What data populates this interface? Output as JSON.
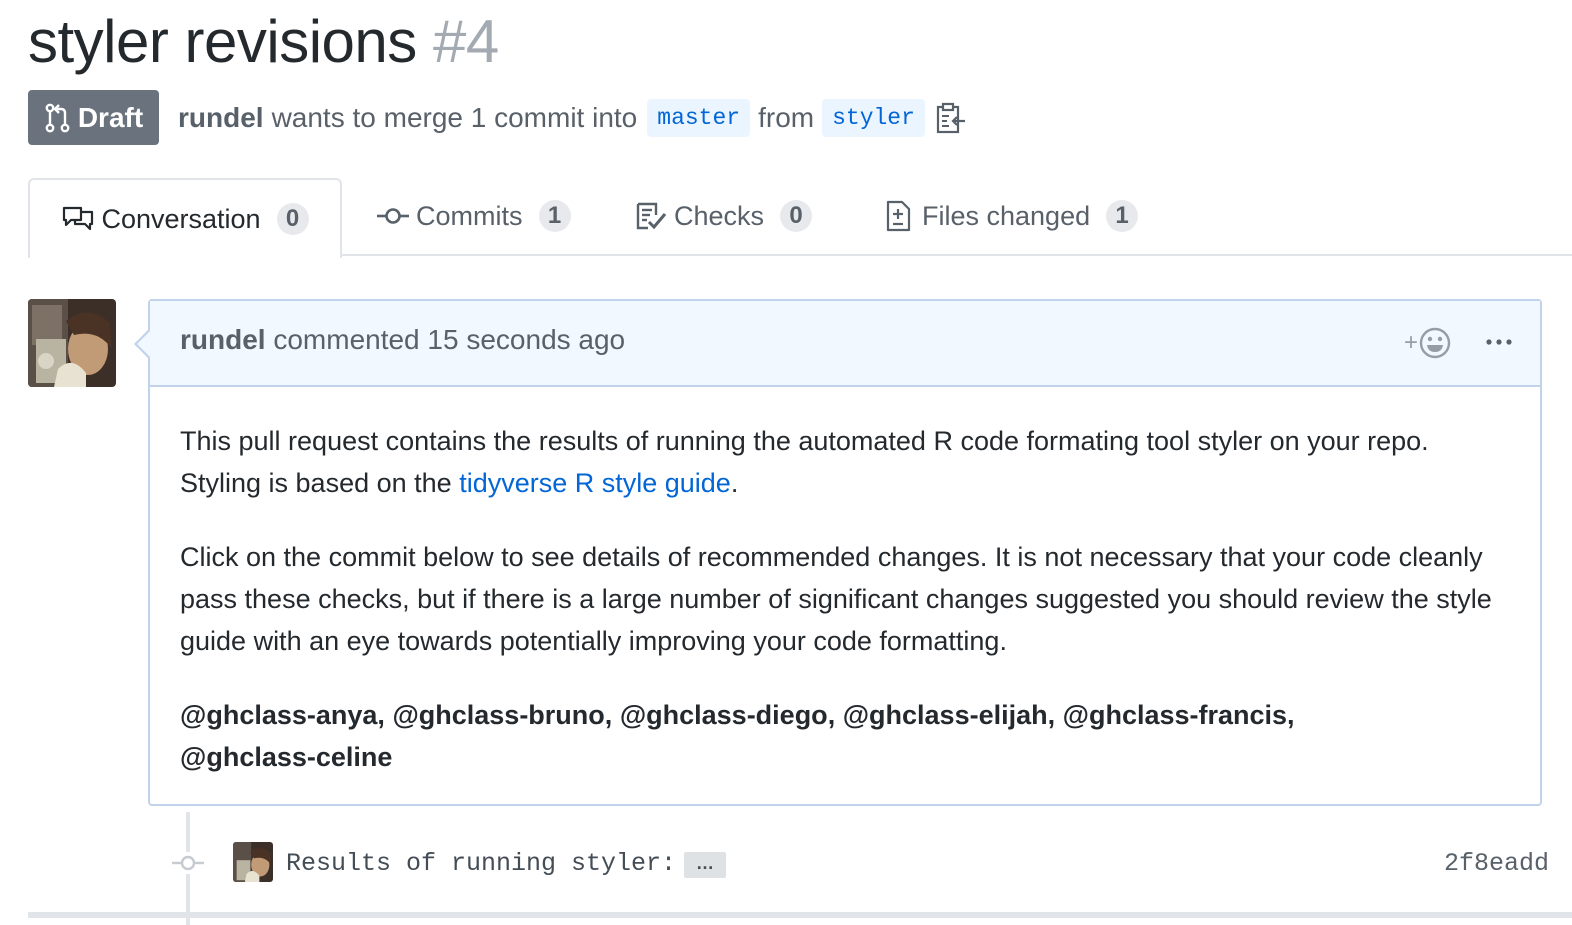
{
  "pr": {
    "title": "styler revisions",
    "number": "#4",
    "status": "Draft",
    "author": "rundel",
    "merge_text": "wants to merge 1 commit into",
    "base_branch": "master",
    "from_text": "from",
    "head_branch": "styler"
  },
  "tabs": [
    {
      "label": "Conversation",
      "count": "0",
      "icon": "comment-discussion-icon"
    },
    {
      "label": "Commits",
      "count": "1",
      "icon": "git-commit-icon"
    },
    {
      "label": "Checks",
      "count": "0",
      "icon": "checklist-icon"
    },
    {
      "label": "Files changed",
      "count": "1",
      "icon": "file-diff-icon"
    }
  ],
  "comment": {
    "author": "rundel",
    "action": "commented",
    "time": "15 seconds ago",
    "p1_before": "This pull request contains the results of running the automated R code formating tool styler on your repo. Styling is based on the ",
    "p1_link": "tidyverse R style guide",
    "p1_after": ".",
    "p2": "Click on the commit below to see details of recommended changes. It is not necessary that your code cleanly pass these checks, but if there is a large number of significant changes suggested you should review the style guide with an eye towards potentially improving your code formatting.",
    "mentions": [
      "@ghclass-anya",
      "@ghclass-bruno",
      "@ghclass-diego",
      "@ghclass-elijah",
      "@ghclass-francis",
      "@ghclass-celine"
    ]
  },
  "commit": {
    "message": "Results of running styler:",
    "ellipsis": "…",
    "sha": "2f8eadd"
  },
  "reaction_plus": "+",
  "colors": {
    "link": "#0366d6",
    "draft_bg": "#6a737d",
    "branch_bg": "#eaf5ff",
    "comment_header_bg": "#f1f8ff",
    "comment_border": "#c0d3eb"
  }
}
